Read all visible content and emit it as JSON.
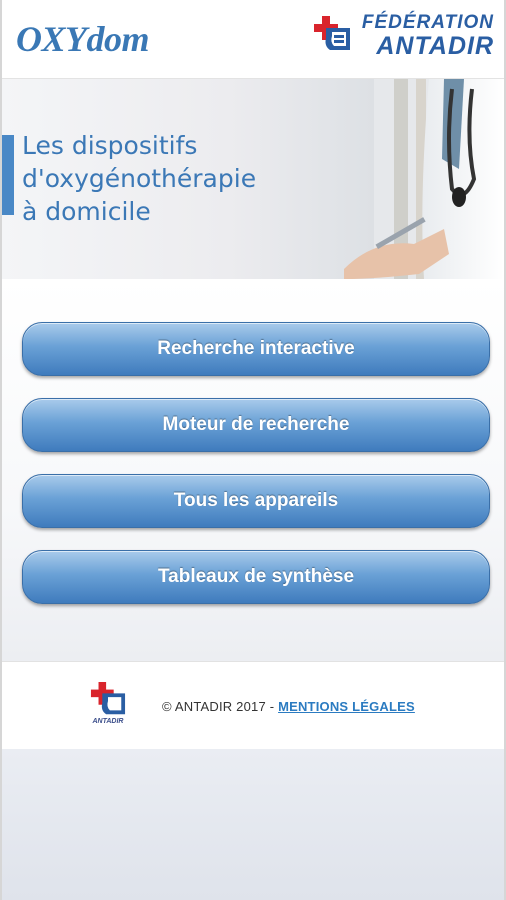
{
  "header": {
    "app_logo": "OXYdom",
    "federation_line1": "FÉDÉRATION",
    "federation_line2": "ANTADIR"
  },
  "banner": {
    "line1": "Les dispositifs",
    "line2": "d'oxygénothérapie",
    "line3": "à domicile"
  },
  "menu": {
    "items": [
      {
        "label": "Recherche interactive"
      },
      {
        "label": "Moteur de recherche"
      },
      {
        "label": "Tous les appareils"
      },
      {
        "label": "Tableaux de synthèse"
      }
    ]
  },
  "footer": {
    "logo_caption": "ANTADIR",
    "copyright": "© ANTADIR 2017 - ",
    "legal_link": "MENTIONS LÉGALES"
  },
  "colors": {
    "brand_blue": "#3a78b5",
    "button_top": "#a9cbeb",
    "button_bottom": "#3f7bbd",
    "federation_red": "#d9242c"
  },
  "icons": [
    "antadir-cross-logo-icon",
    "doctor-illustration"
  ]
}
